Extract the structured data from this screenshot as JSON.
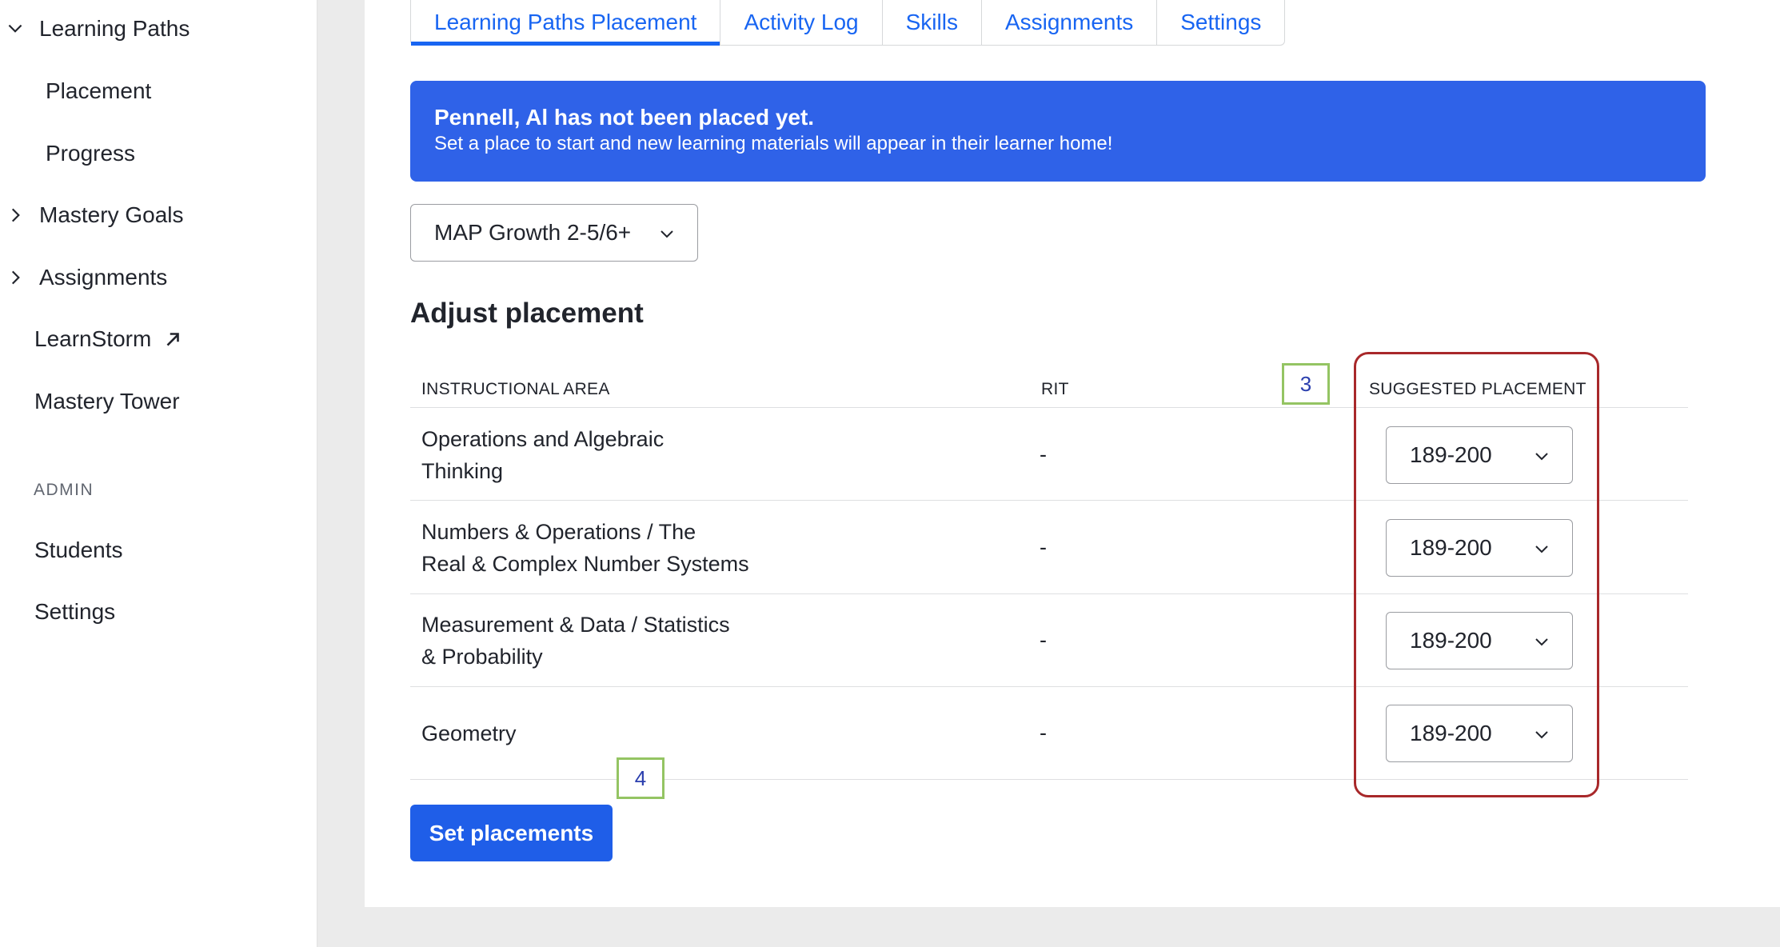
{
  "sidebar": {
    "items": [
      {
        "label": "Learning Paths",
        "icon": "chevron-down-icon"
      },
      {
        "label": "Placement"
      },
      {
        "label": "Progress"
      },
      {
        "label": "Mastery Goals",
        "icon": "chevron-right-icon"
      },
      {
        "label": "Assignments",
        "icon": "chevron-right-icon"
      },
      {
        "label": "LearnStorm",
        "icon": "external-link-icon"
      },
      {
        "label": "Mastery Tower"
      }
    ],
    "admin_section": "ADMIN",
    "admin_items": [
      {
        "label": "Students"
      },
      {
        "label": "Settings"
      }
    ]
  },
  "tabs": [
    {
      "label": "Learning Paths Placement",
      "active": true
    },
    {
      "label": "Activity Log"
    },
    {
      "label": "Skills"
    },
    {
      "label": "Assignments"
    },
    {
      "label": "Settings"
    }
  ],
  "banner": {
    "title": "Pennell, Al has not been placed yet.",
    "body": "Set a place to start and new learning materials will appear in their learner home!"
  },
  "assessment_dropdown": {
    "value": "MAP Growth 2-5/6+"
  },
  "heading": "Adjust placement",
  "table": {
    "headers": [
      "INSTRUCTIONAL AREA",
      "RIT",
      "SUGGESTED PLACEMENT"
    ],
    "rows": [
      {
        "area_line1": "Operations and Algebraic",
        "area_line2": "Thinking",
        "rit": "-",
        "placement": "189-200"
      },
      {
        "area_line1": "Numbers & Operations / The",
        "area_line2": "Real & Complex Number Systems",
        "rit": "-",
        "placement": "189-200"
      },
      {
        "area_line1": "Measurement & Data / Statistics",
        "area_line2": "& Probability",
        "rit": "-",
        "placement": "189-200"
      },
      {
        "area_line1": "Geometry",
        "area_line2": "",
        "rit": "-",
        "placement": "189-200"
      }
    ]
  },
  "markers": {
    "m3": "3",
    "m4": "4"
  },
  "set_button": "Set placements",
  "colors": {
    "accent": "#1865f2",
    "banner": "#2f62e8",
    "highlight": "#a8282a",
    "marker_border": "#94c463"
  }
}
